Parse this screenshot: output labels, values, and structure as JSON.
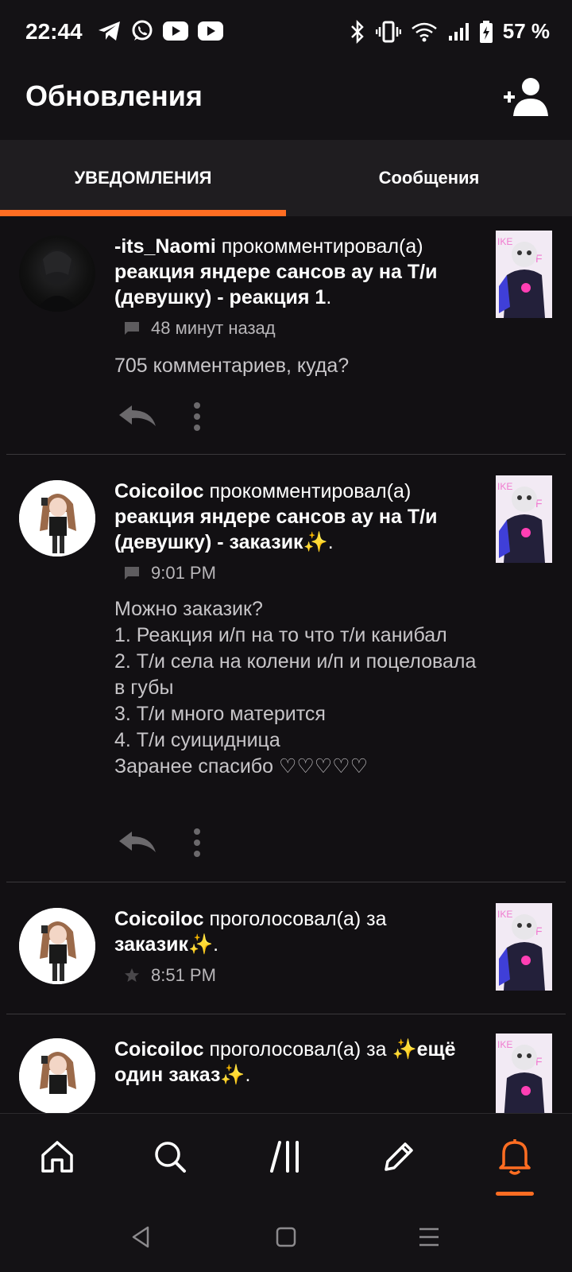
{
  "status_bar": {
    "time": "22:44",
    "battery": "57 %",
    "left_icons": [
      "telegram-icon",
      "whatsapp-icon",
      "youtube-icon",
      "youtube-icon"
    ],
    "right_icons": [
      "bluetooth-icon",
      "vibrate-icon",
      "wifi-icon",
      "signal-icon",
      "battery-charging-icon"
    ]
  },
  "header": {
    "title": "Обновления",
    "add_user_icon": "add-user-icon"
  },
  "tabs": [
    {
      "label": "УВЕДОМЛЕНИЯ",
      "active": true
    },
    {
      "label": "Сообщения",
      "active": false
    }
  ],
  "notifications": [
    {
      "user": "-its_Naomi",
      "action": " прокомментировал(а) ",
      "target": "реакция яндере сансов ау на Т/и (девушку) - реакция 1",
      "suffix": ".",
      "meta_icon": "comment-icon",
      "time": "48 минут назад",
      "comment": "705 комментариев, куда?"
    },
    {
      "user": "Coicoiloc",
      "action": " прокомментировал(а) ",
      "target": "реакция яндере сансов ау на Т/и (девушку) - заказик✨",
      "suffix": ".",
      "meta_icon": "comment-icon",
      "time": "9:01 PM",
      "comment": "Можно заказик?\n1. Реакция и/п на то что т/и канибал\n2. Т/и села на колени и/п и поцеловала в губы\n3. Т/и много матерится\n4. Т/и суицидница\nЗаранее спасибо ♡♡♡♡♡"
    },
    {
      "user": "Coicoiloc",
      "action": " проголосовал(а) за ",
      "target": "заказик✨",
      "suffix": ".",
      "meta_icon": "star-icon",
      "time": "8:51 PM"
    },
    {
      "user": "Coicoiloc",
      "action": " проголосовал(а) за ",
      "target": "✨ещё один заказ✨",
      "suffix": "."
    }
  ],
  "bottom_nav": [
    "home-icon",
    "search-icon",
    "library-icon",
    "write-icon",
    "notifications-bell-icon"
  ],
  "colors": {
    "accent": "#ff6d22",
    "background": "#121013",
    "tabbar": "#1f1d20",
    "muted_text": "#b8b6b9"
  }
}
